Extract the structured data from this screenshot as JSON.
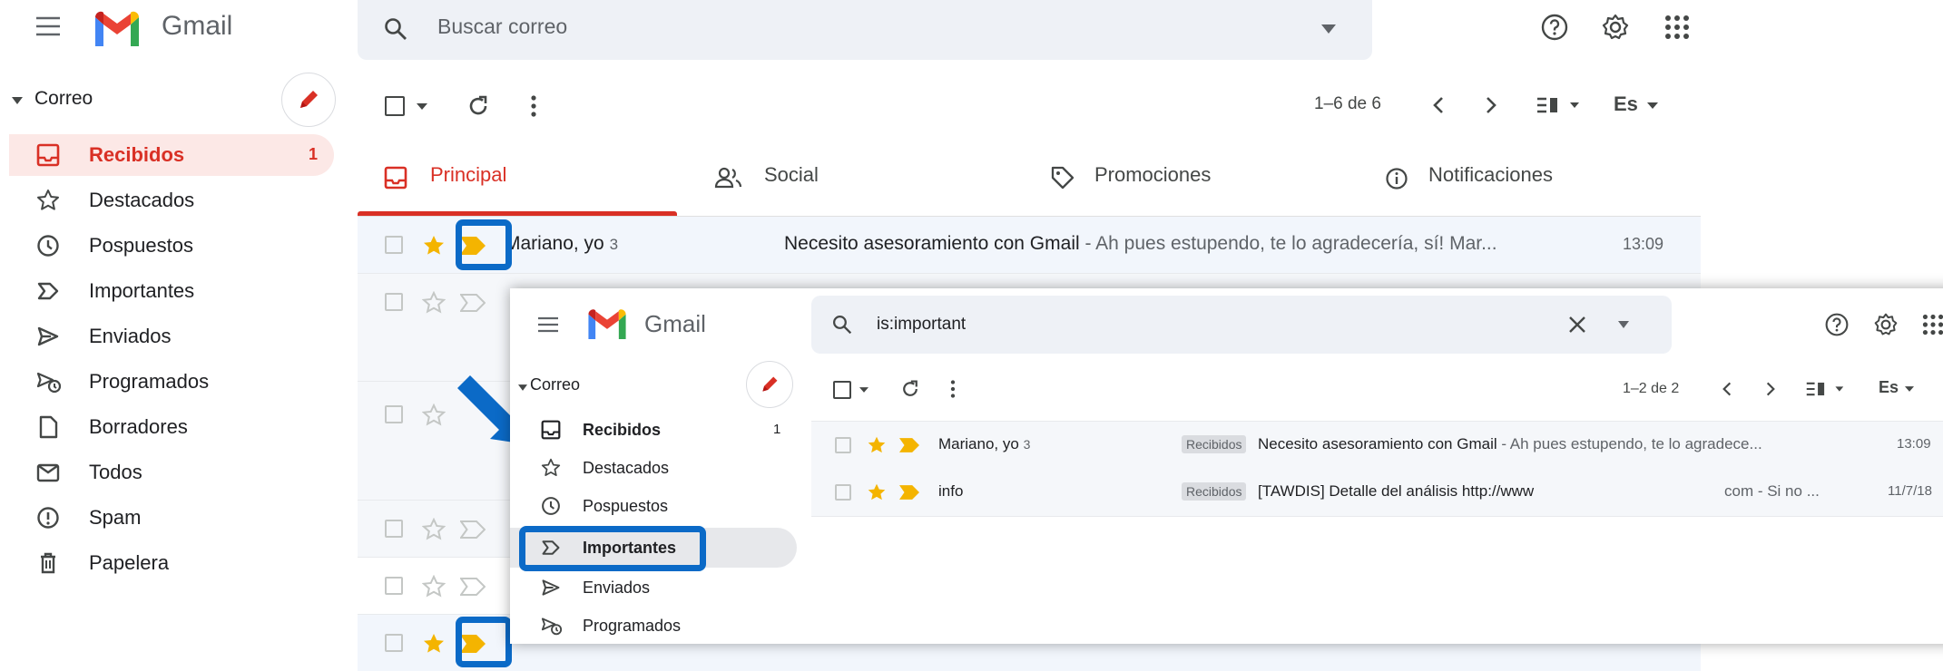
{
  "bg": {
    "app_name": "Gmail",
    "search_placeholder": "Buscar correo",
    "mail_section": "Correo",
    "nav": [
      {
        "label": "Recibidos",
        "count": "1",
        "icon": "inbox-icon"
      },
      {
        "label": "Destacados",
        "icon": "star-outline-icon"
      },
      {
        "label": "Pospuestos",
        "icon": "clock-icon"
      },
      {
        "label": "Importantes",
        "icon": "important-icon"
      },
      {
        "label": "Enviados",
        "icon": "send-icon"
      },
      {
        "label": "Programados",
        "icon": "scheduled-icon"
      },
      {
        "label": "Borradores",
        "icon": "draft-icon"
      },
      {
        "label": "Todos",
        "icon": "all-mail-icon"
      },
      {
        "label": "Spam",
        "icon": "spam-icon"
      },
      {
        "label": "Papelera",
        "icon": "trash-icon"
      }
    ],
    "pagination": "1–6 de 6",
    "lang": "Es",
    "tabs": [
      {
        "label": "Principal",
        "icon": "inbox-icon"
      },
      {
        "label": "Social",
        "icon": "people-icon"
      },
      {
        "label": "Promociones",
        "icon": "tag-icon"
      },
      {
        "label": "Notificaciones",
        "icon": "info-icon"
      }
    ],
    "first_row": {
      "sender": "Mariano, yo",
      "count": "3",
      "subject": "Necesito asesoramiento con Gmail",
      "snippet": " - Ah pues estupendo, te lo agradecería, sí! Mar...",
      "time": "13:09"
    }
  },
  "overlay": {
    "app_name": "Gmail",
    "search_value": "is:important",
    "mail_section": "Correo",
    "nav": [
      {
        "label": "Recibidos",
        "count": "1",
        "icon": "inbox-icon"
      },
      {
        "label": "Destacados",
        "icon": "star-outline-icon"
      },
      {
        "label": "Pospuestos",
        "icon": "clock-icon"
      },
      {
        "label": "Importantes",
        "icon": "important-icon"
      },
      {
        "label": "Enviados",
        "icon": "send-icon"
      },
      {
        "label": "Programados",
        "icon": "scheduled-icon"
      }
    ],
    "pagination": "1–2 de 2",
    "lang": "Es",
    "rows": [
      {
        "sender": "Mariano, yo",
        "count": "3",
        "label": "Recibidos",
        "subject": "Necesito asesoramiento con Gmail",
        "snippet": " - Ah pues estupendo, te lo agradece...",
        "time": "13:09"
      },
      {
        "sender": "info",
        "count": "",
        "label": "Recibidos",
        "subject": "[TAWDIS] Detalle del análisis http://www",
        "snippet": "com - Si no ...",
        "time": "11/7/18"
      }
    ]
  },
  "colors": {
    "accent_red": "#d93025",
    "star_yellow": "#f4b400",
    "important_yellow": "#f4b400",
    "highlight_blue": "#0b6ac7",
    "inbox_selected_bg": "#fce8e6"
  }
}
